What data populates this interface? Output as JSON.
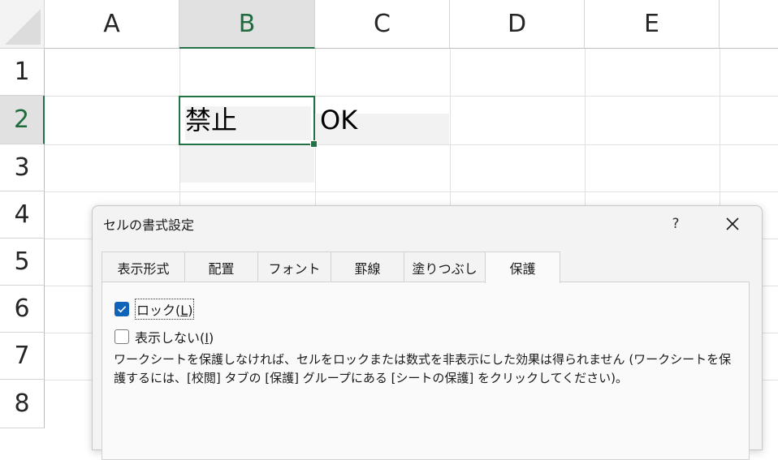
{
  "sheet": {
    "columns": [
      "A",
      "B",
      "C",
      "D",
      "E"
    ],
    "rows": [
      "1",
      "2",
      "3",
      "4",
      "5",
      "6",
      "7",
      "8"
    ],
    "cells": {
      "B2": "禁止",
      "C2": "OK"
    }
  },
  "dialog": {
    "title": "セルの書式設定",
    "help": "?",
    "tabs": [
      "表示形式",
      "配置",
      "フォント",
      "罫線",
      "塗りつぶし",
      "保護"
    ],
    "active_tab": "保護",
    "lock": {
      "label": "ロック",
      "hotkey_open": "(",
      "hotkey": "L",
      "hotkey_close": ")",
      "checked": true
    },
    "hidden": {
      "label": "表示しない",
      "hotkey_open": "(",
      "hotkey": "I",
      "hotkey_close": ")",
      "checked": false
    },
    "description_line1": "ワークシートを保護しなければ、セルをロックまたは数式を非表示にした効果は得られません (ワークシートを保",
    "description_line2": "護するには、[校閲] タブの [保護] グループにある [シートの保護] をクリックしてください)。"
  },
  "colors": {
    "accent": "#217346",
    "checkbox": "#0f63b8"
  }
}
